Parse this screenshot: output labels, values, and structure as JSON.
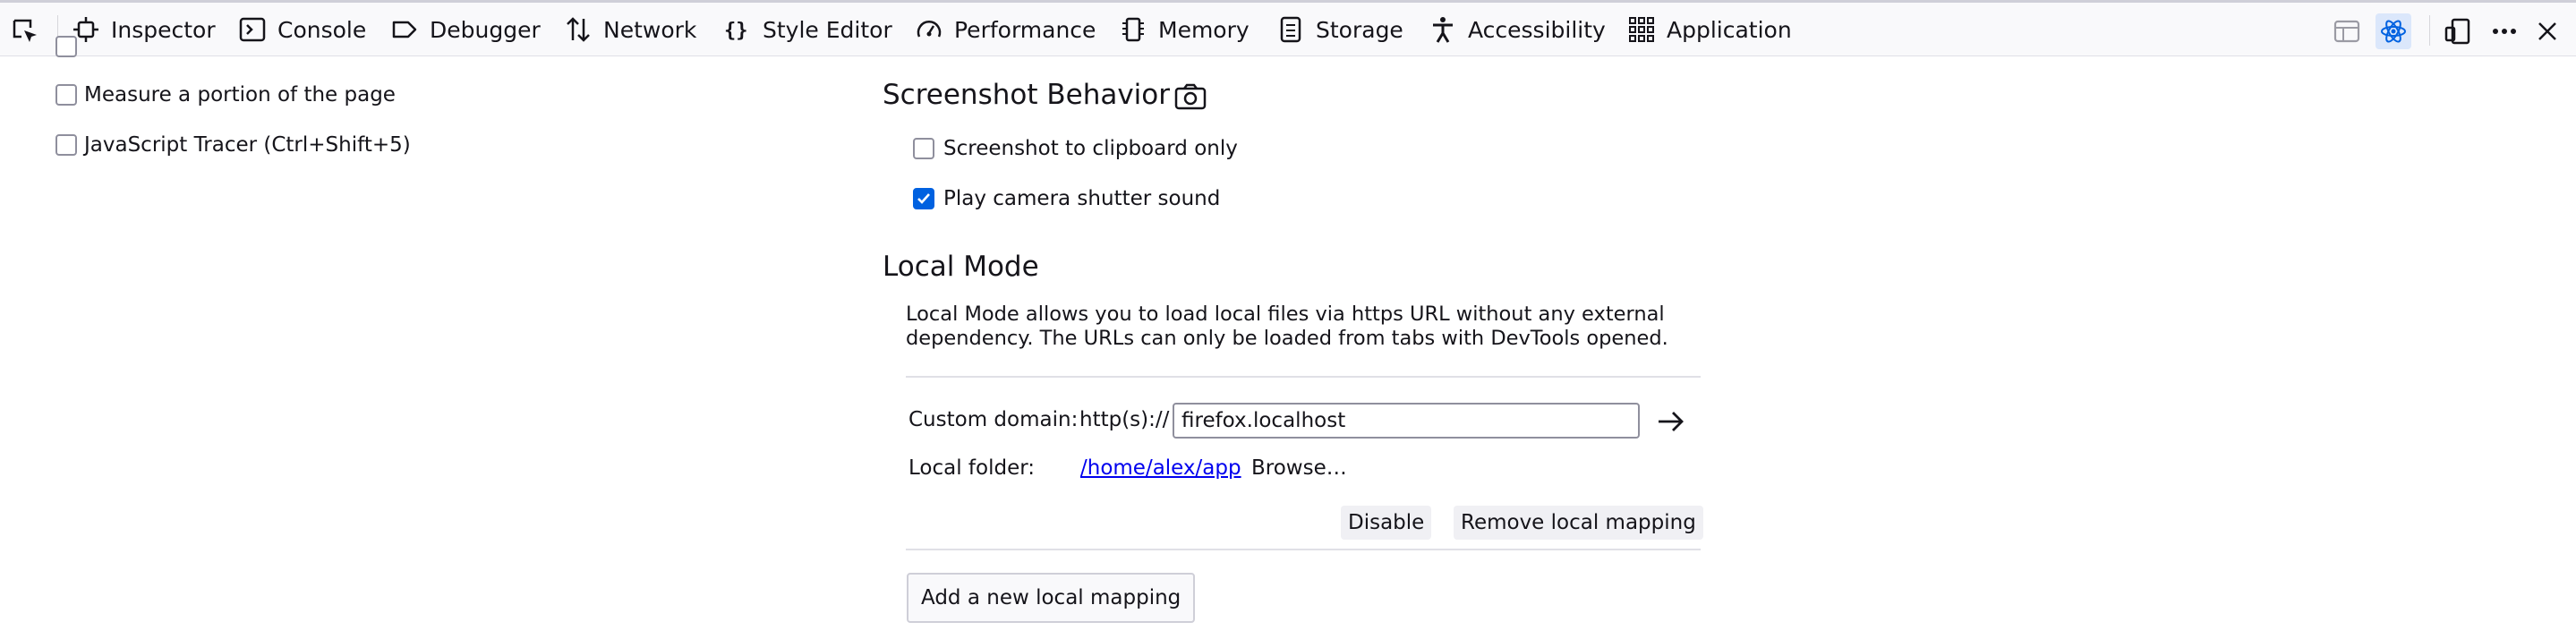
{
  "toolbar": {
    "tabs": [
      {
        "label": "Inspector",
        "icon": "inspector-icon"
      },
      {
        "label": "Console",
        "icon": "console-icon"
      },
      {
        "label": "Debugger",
        "icon": "debugger-icon"
      },
      {
        "label": "Network",
        "icon": "network-icon"
      },
      {
        "label": "Style Editor",
        "icon": "style-editor-icon"
      },
      {
        "label": "Performance",
        "icon": "performance-icon"
      },
      {
        "label": "Memory",
        "icon": "memory-icon"
      },
      {
        "label": "Storage",
        "icon": "storage-icon"
      },
      {
        "label": "Accessibility",
        "icon": "accessibility-icon"
      },
      {
        "label": "Application",
        "icon": "application-icon"
      }
    ]
  },
  "left_options": {
    "measure_label": "Measure a portion of the page",
    "measure_checked": false,
    "tracer_label": "JavaScript Tracer (Ctrl+Shift+5)",
    "tracer_checked": false
  },
  "screenshot": {
    "heading": "Screenshot Behavior",
    "clipboard_label": "Screenshot to clipboard only",
    "clipboard_checked": false,
    "shutter_label": "Play camera shutter sound",
    "shutter_checked": true
  },
  "local_mode": {
    "heading": "Local Mode",
    "description": "Local Mode allows you to load local files via https URL without any external dependency. The URLs can only be loaded from tabs with DevTools opened.",
    "custom_domain_label": "Custom domain:",
    "scheme_prefix": "http(s)://",
    "domain_value": "firefox.localhost",
    "local_folder_label": "Local folder:",
    "folder_path": "/home/alex/app",
    "browse_label": "Browse…",
    "disable_label": "Disable",
    "remove_label": "Remove local mapping",
    "add_label": "Add a new local mapping"
  },
  "colors": {
    "accent": "#0061e0",
    "link": "#0000ee",
    "toolbar_bg": "#f9f9fb"
  }
}
